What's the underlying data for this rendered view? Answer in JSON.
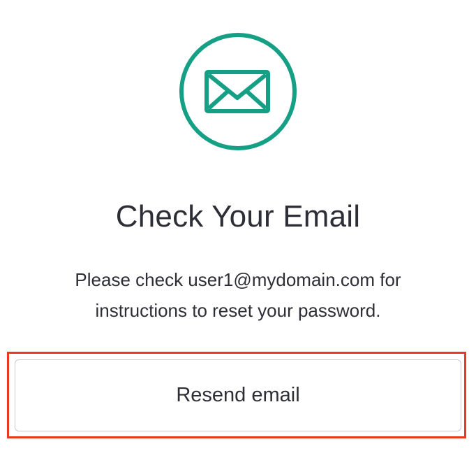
{
  "icon": {
    "name": "envelope-icon",
    "color": "#15a085"
  },
  "title": "Check Your Email",
  "message": {
    "line1": "Please check user1@mydomain.com for",
    "line2": "instructions to reset your password."
  },
  "resend_button": {
    "label": "Resend email"
  },
  "colors": {
    "accent": "#15a085",
    "text": "#2d2e36",
    "button_border": "#c9cace",
    "highlight": "#e83a1f"
  }
}
